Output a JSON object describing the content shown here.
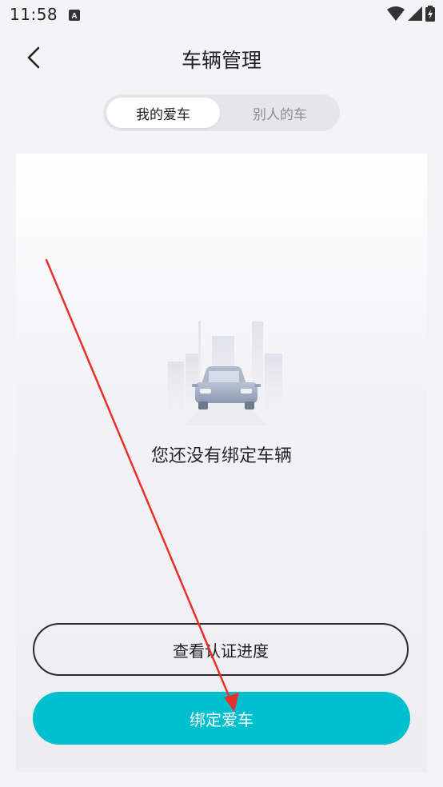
{
  "status_bar": {
    "time": "11:58"
  },
  "header": {
    "title": "车辆管理"
  },
  "tabs": [
    {
      "label": "我的爱车",
      "active": true
    },
    {
      "label": "别人的车",
      "active": false
    }
  ],
  "empty_state": {
    "message": "您还没有绑定车辆"
  },
  "actions": {
    "view_progress_label": "查看认证进度",
    "bind_car_label": "绑定爱车"
  },
  "colors": {
    "accent": "#00bfcf",
    "annotation": "#e8302a"
  }
}
